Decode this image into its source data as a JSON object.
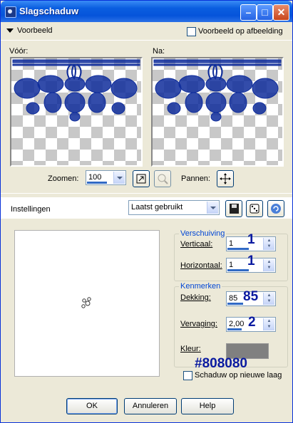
{
  "window": {
    "title": "Slagschaduw"
  },
  "preview_section": {
    "label": "Voorbeeld",
    "show_on_image_label": "Voorbeeld op afbeelding",
    "before_label": "Vóór:",
    "after_label": "Na:"
  },
  "zoom": {
    "label": "Zoomen:",
    "value": "100",
    "pan_label": "Pannen:"
  },
  "settings": {
    "label": "Instellingen",
    "preset": "Laatst gebruikt"
  },
  "offset": {
    "title": "Verschuiving",
    "vertical_label": "Verticaal:",
    "vertical_value": "1",
    "horizontal_label": "Horizontaal:",
    "horizontal_value": "1"
  },
  "attributes": {
    "title": "Kenmerken",
    "opacity_label": "Dekking:",
    "opacity_value": "85",
    "blur_label": "Vervaging:",
    "blur_value": "2,00",
    "color_label": "Kleur:",
    "color_swatch": "#808080"
  },
  "annotations": {
    "vertical": "1",
    "horizontal": "1",
    "opacity": "85",
    "blur": "2",
    "color": "#808080"
  },
  "new_layer_label": "Schaduw op nieuwe laag",
  "buttons": {
    "ok": "OK",
    "cancel": "Annuleren",
    "help": "Help"
  },
  "colors": {
    "lace": "#0f2d9b",
    "annotation": "#0a1aa0"
  }
}
